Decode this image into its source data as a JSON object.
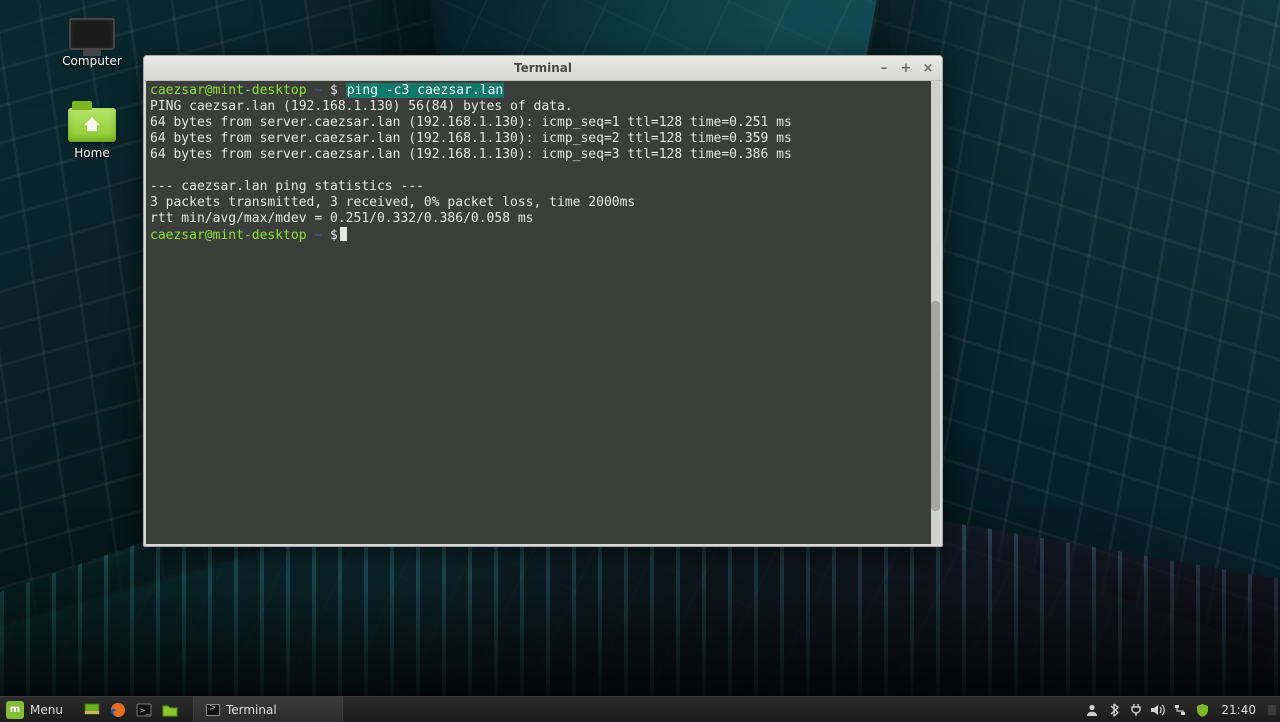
{
  "desktop": {
    "icons": [
      {
        "id": "computer",
        "label": "Computer"
      },
      {
        "id": "home",
        "label": "Home"
      }
    ]
  },
  "window": {
    "title": "Terminal",
    "buttons": {
      "min": "–",
      "max": "+",
      "close": "×"
    }
  },
  "terminal": {
    "prompt_user": "caezsar@mint-desktop",
    "prompt_path": "~",
    "prompt_symbol": "$",
    "command": "ping -c3 caezsar.lan",
    "output": [
      "PING caezsar.lan (192.168.1.130) 56(84) bytes of data.",
      "64 bytes from server.caezsar.lan (192.168.1.130): icmp_seq=1 ttl=128 time=0.251 ms",
      "64 bytes from server.caezsar.lan (192.168.1.130): icmp_seq=2 ttl=128 time=0.359 ms",
      "64 bytes from server.caezsar.lan (192.168.1.130): icmp_seq=3 ttl=128 time=0.386 ms",
      "",
      "--- caezsar.lan ping statistics ---",
      "3 packets transmitted, 3 received, 0% packet loss, time 2000ms",
      "rtt min/avg/max/mdev = 0.251/0.332/0.386/0.058 ms"
    ]
  },
  "taskbar": {
    "menu_label": "Menu",
    "task_label": "Terminal",
    "clock": "21:40"
  }
}
